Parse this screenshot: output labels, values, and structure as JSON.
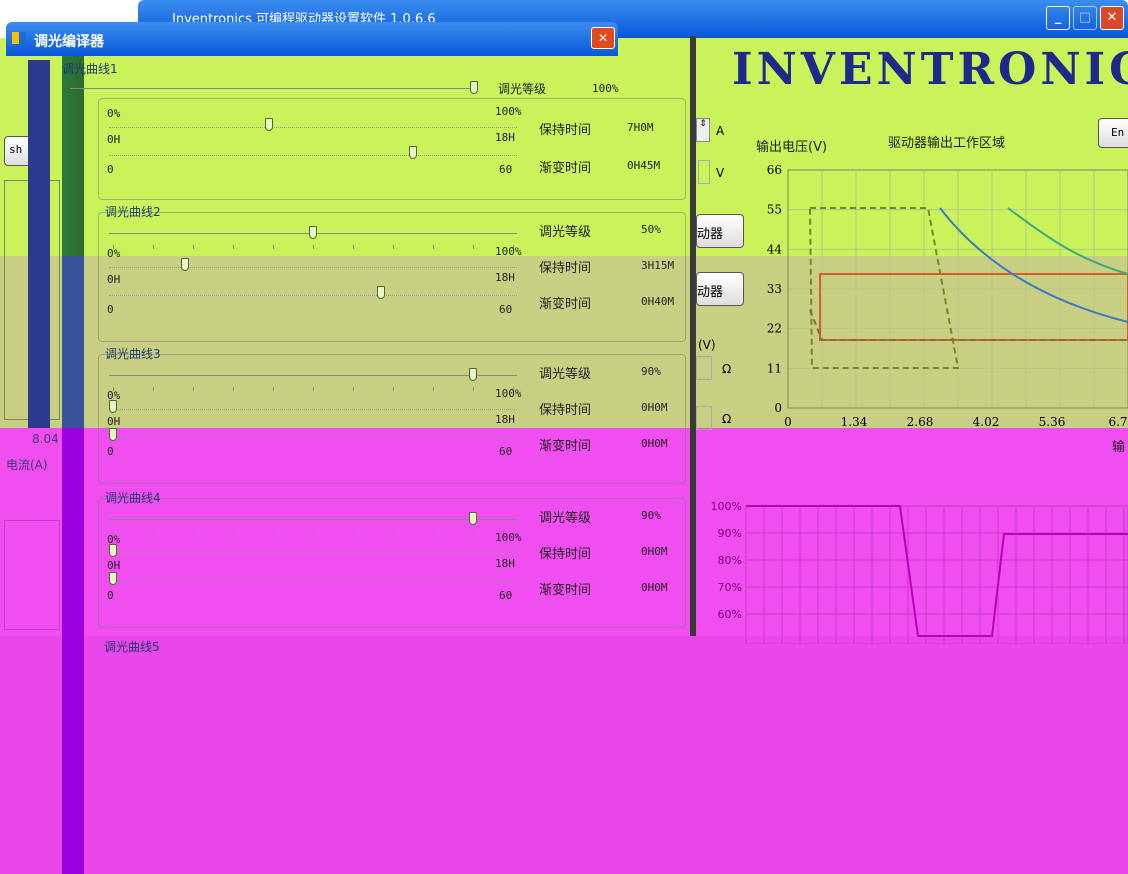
{
  "main_window": {
    "title": "Inventronics 可编程驱动器设置软件 1.0.6.6"
  },
  "dialog": {
    "title": "调光编译器",
    "close": "✕"
  },
  "logo": {
    "text": "INVENTRONICS"
  },
  "curves": [
    {
      "name": "调光曲线1",
      "level_label": "调光等级",
      "level": "100%",
      "hold_label": "保持时间",
      "hold": "7H0M",
      "fade_label": "渐变时间",
      "fade": "0H45M",
      "scale_min": "0%",
      "scale_max": "100%",
      "hold_min": "0H",
      "hold_max": "18H",
      "fade_min": "0",
      "fade_max": "60"
    },
    {
      "name": "调光曲线2",
      "level_label": "调光等级",
      "level": "50%",
      "hold_label": "保持时间",
      "hold": "3H15M",
      "fade_label": "渐变时间",
      "fade": "0H40M",
      "scale_min": "0%",
      "scale_max": "100%",
      "hold_min": "0H",
      "hold_max": "18H",
      "fade_min": "0",
      "fade_max": "60"
    },
    {
      "name": "调光曲线3",
      "level_label": "调光等级",
      "level": "90%",
      "hold_label": "保持时间",
      "hold": "0H0M",
      "fade_label": "渐变时间",
      "fade": "0H0M",
      "scale_min": "0%",
      "scale_max": "100%",
      "hold_min": "0H",
      "hold_max": "18H",
      "fade_min": "0",
      "fade_max": "60"
    },
    {
      "name": "调光曲线4",
      "level_label": "调光等级",
      "level": "90%",
      "hold_label": "保持时间",
      "hold": "0H0M",
      "fade_label": "渐变时间",
      "fade": "0H0M",
      "scale_min": "0%",
      "scale_max": "100%",
      "hold_min": "0H",
      "hold_max": "18H",
      "fade_min": "0",
      "fade_max": "60"
    },
    {
      "name": "调光曲线5"
    }
  ],
  "left_panel": {
    "refresh_btn": "sh",
    "value": "8.04",
    "current_label": "电流(A)"
  },
  "middle": {
    "unit_a": "A",
    "unit_v": "V",
    "btn1": "动器",
    "btn2": "动器",
    "v_label": "(V)",
    "ohm1": "Ω",
    "ohm2": "Ω"
  },
  "work_area": {
    "title": "驱动器输出工作区域",
    "ylabel": "输出电压(V)",
    "button": "En",
    "xlabel": "输",
    "y_ticks": [
      "66",
      "55",
      "44",
      "33",
      "22",
      "11",
      "0"
    ],
    "x_ticks": [
      "0",
      "1.34",
      "2.68",
      "4.02",
      "5.36",
      "6.7"
    ]
  },
  "dim_chart": {
    "y_ticks": [
      "100%",
      "90%",
      "80%",
      "70%",
      "60%"
    ]
  },
  "colors": {
    "lime": "#c9f25b",
    "olive": "#c9cf82",
    "magenta": "#f04ef0",
    "title_blue": "#0a57d8"
  }
}
